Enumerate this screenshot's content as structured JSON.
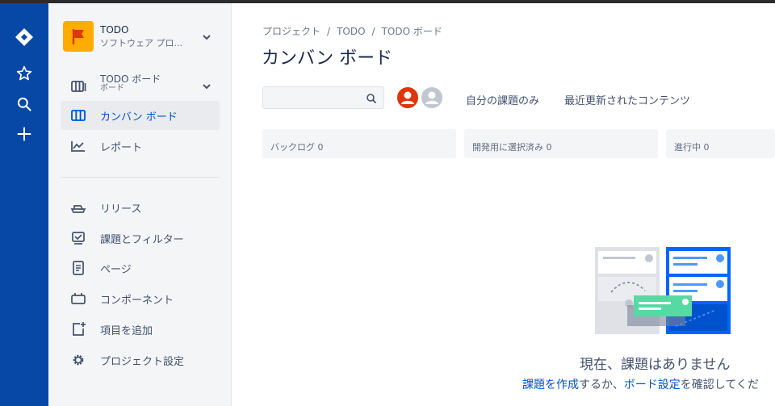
{
  "global_nav": {
    "items": [
      "jira-logo",
      "star-icon",
      "search-icon",
      "plus-icon"
    ]
  },
  "project": {
    "name": "TODO",
    "type": "ソフトウェア プロ..."
  },
  "sidebar": {
    "board_switcher": {
      "label": "TODO ボード",
      "sub": "ボード"
    },
    "items": [
      {
        "label": "カンバン ボード",
        "icon": "board-icon",
        "active": true
      },
      {
        "label": "レポート",
        "icon": "chart-icon",
        "active": false
      }
    ],
    "items2": [
      {
        "label": "リリース",
        "icon": "ship-icon"
      },
      {
        "label": "課題とフィルター",
        "icon": "issues-icon"
      },
      {
        "label": "ページ",
        "icon": "page-icon"
      },
      {
        "label": "コンポーネント",
        "icon": "component-icon"
      },
      {
        "label": "項目を追加",
        "icon": "add-item-icon"
      },
      {
        "label": "プロジェクト設定",
        "icon": "gear-icon"
      }
    ]
  },
  "breadcrumbs": [
    "プロジェクト",
    "TODO",
    "TODO ボード"
  ],
  "breadcrumb_sep": "/",
  "page_title": "カンバン ボード",
  "search": {
    "placeholder": ""
  },
  "filters": [
    "自分の課題のみ",
    "最近更新されたコンテンツ"
  ],
  "columns": [
    "バックログ 0",
    "開発用に選択済み 0",
    "進行中 0"
  ],
  "empty": {
    "title": "現在、課題はありません",
    "link1": "課題を作成",
    "text1": "するか、",
    "link2": "ボード設定",
    "text2": "を確認してくだ"
  },
  "colors": {
    "global_nav": "#0747a6",
    "sidebar_bg": "#f4f5f7",
    "active_text": "#0052cc",
    "avatar_red": "#de350b",
    "project_avatar": "#ffab00"
  }
}
